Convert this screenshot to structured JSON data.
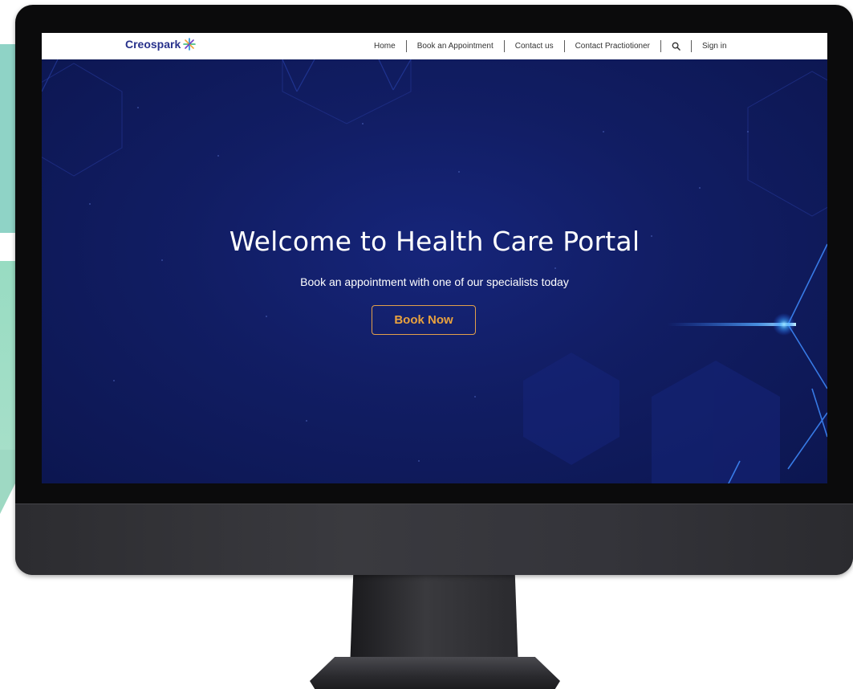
{
  "brand": {
    "name": "Creospark",
    "logo_icon": "starburst-icon",
    "color": "#27318b"
  },
  "nav": {
    "items": [
      {
        "label": "Home"
      },
      {
        "label": "Book an Appointment"
      },
      {
        "label": "Contact us"
      },
      {
        "label": "Contact Practiotioner"
      }
    ],
    "search_icon": "search-icon",
    "signin_label": "Sign in"
  },
  "hero": {
    "title": "Welcome to Health Care Portal",
    "subtitle": "Book an appointment with one of our specialists today",
    "cta_label": "Book Now",
    "cta_color": "#e9a23e",
    "background_color": "#111d63"
  }
}
